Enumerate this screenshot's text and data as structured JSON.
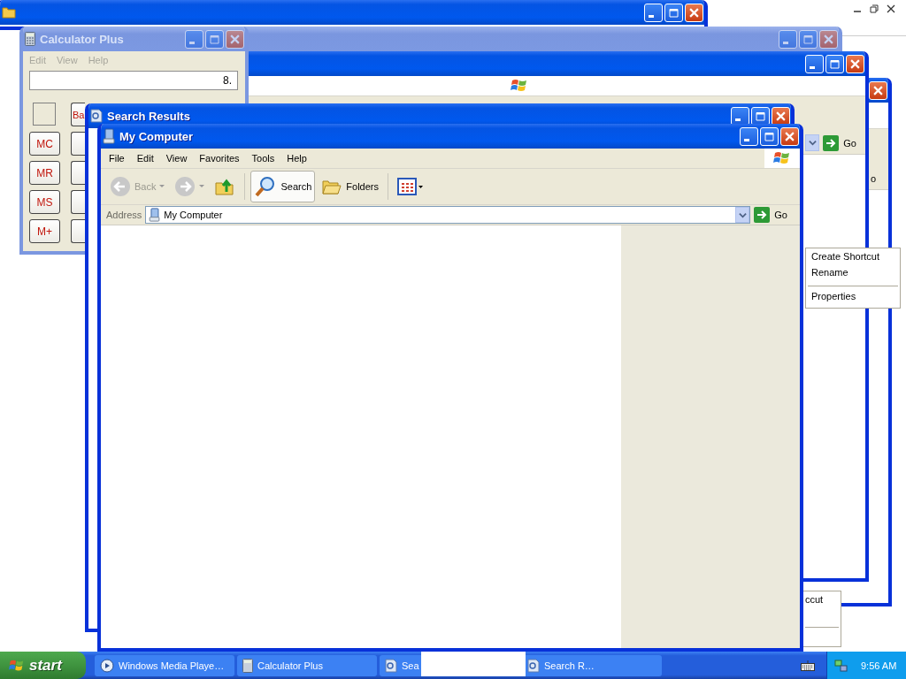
{
  "background_windows": [
    {
      "active": true
    },
    {
      "active": false
    },
    {
      "active": true,
      "go": "Go"
    },
    {
      "active": true,
      "go": "o"
    }
  ],
  "calculator": {
    "title": "Calculator Plus",
    "active": false,
    "menu": [
      "Edit",
      "View",
      "Help"
    ],
    "display": "8.",
    "wide_key": "Ba",
    "memory_keys": [
      "MC",
      "MR",
      "MS",
      "M+"
    ]
  },
  "search_results": {
    "title": "Search Results",
    "active": true
  },
  "my_computer": {
    "title": "My Computer",
    "active": true,
    "menu": [
      "File",
      "Edit",
      "View",
      "Favorites",
      "Tools",
      "Help"
    ],
    "toolbar": [
      {
        "kind": "back",
        "label": "Back",
        "disabled": true
      },
      {
        "kind": "forward",
        "disabled": true
      },
      {
        "kind": "up"
      },
      {
        "kind": "search",
        "label": "Search",
        "selected": true
      },
      {
        "kind": "folders",
        "label": "Folders",
        "selected": false
      },
      {
        "kind": "views"
      }
    ],
    "address": {
      "label": "Address",
      "value": "My Computer",
      "go": "Go"
    }
  },
  "context_menu": [
    {
      "kind": "item",
      "label": "Create Shortcut"
    },
    {
      "kind": "item",
      "label": "Rename"
    },
    {
      "kind": "separator"
    },
    {
      "kind": "item",
      "label": "Properties"
    }
  ],
  "menu_fragment": [
    {
      "kind": "item",
      "label": "ccut"
    },
    {
      "kind": "separator"
    }
  ],
  "taskbar": {
    "start": "start",
    "tasks": [
      {
        "kind": "media",
        "label": "Windows Media Playe…"
      },
      {
        "kind": "calculator",
        "label": "Calculator Plus"
      },
      {
        "kind": "search",
        "label": "Sea"
      },
      {
        "kind": "search",
        "label": "Search R…"
      }
    ],
    "clock": "9:56 AM"
  }
}
